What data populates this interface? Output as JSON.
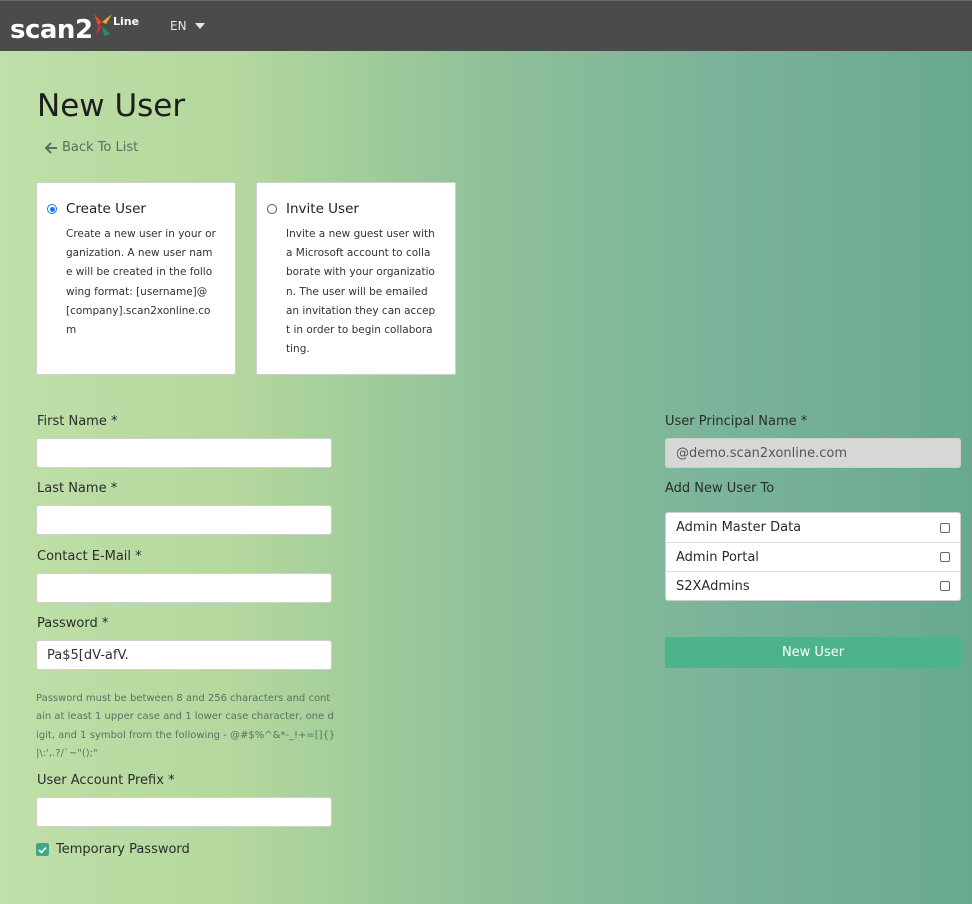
{
  "header": {
    "logo_word": "scan2",
    "logo_suffix": "Line",
    "language": "EN",
    "accent_colors": [
      "#e8432f",
      "#f5a623",
      "#2a8c6a"
    ]
  },
  "page": {
    "title": "New User",
    "back_label": "Back To List"
  },
  "mode_cards": [
    {
      "title": "Create User",
      "selected": true,
      "description": "Create a new user in your organization. A new user name will be created in the following format: [username]@[company].scan2xonline.com"
    },
    {
      "title": "Invite User",
      "selected": false,
      "description": "Invite a new guest user with a Microsoft account to collaborate with your organization. The user will be emailed an invitation they can accept in order to begin collaborating."
    }
  ],
  "form": {
    "first_name_label": "First Name *",
    "first_name_value": "",
    "last_name_label": "Last Name *",
    "last_name_value": "",
    "email_label": "Contact E-Mail *",
    "email_value": "",
    "password_label": "Password *",
    "password_value": "Pa$5[dV-afV.",
    "password_hint": "Password must be between 8 and 256 characters and contain at least 1 upper case and 1 lower case character, one digit, and 1 symbol from the following - @#$%^&*-_!+=[]{}|\\:',.?/`~\"();\"",
    "prefix_label": "User Account Prefix *",
    "prefix_value": "",
    "temp_password_label": "Temporary Password",
    "temp_password_checked": true
  },
  "right": {
    "upn_label": "User Principal Name *",
    "upn_value": "@demo.scan2xonline.com",
    "groups_label": "Add New User To",
    "groups": [
      {
        "name": "Admin Master Data",
        "checked": false
      },
      {
        "name": "Admin Portal",
        "checked": false
      },
      {
        "name": "S2XAdmins",
        "checked": false
      }
    ],
    "submit_label": "New User",
    "submit_color": "#4cb38a"
  }
}
